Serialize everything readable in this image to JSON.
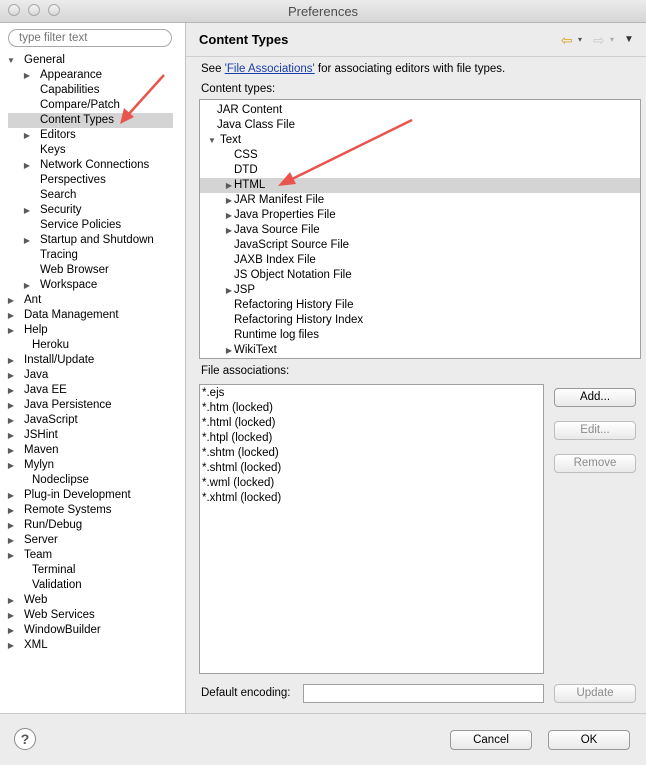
{
  "window": {
    "title": "Preferences"
  },
  "filter": {
    "placeholder": "type filter text"
  },
  "sidebar": {
    "items": [
      {
        "label": "General",
        "level": 0,
        "twisty": "open"
      },
      {
        "label": "Appearance",
        "level": 1,
        "twisty": "closed"
      },
      {
        "label": "Capabilities",
        "level": 1,
        "twisty": "none"
      },
      {
        "label": "Compare/Patch",
        "level": 1,
        "twisty": "none"
      },
      {
        "label": "Content Types",
        "level": 1,
        "twisty": "none",
        "selected": true
      },
      {
        "label": "Editors",
        "level": 1,
        "twisty": "closed"
      },
      {
        "label": "Keys",
        "level": 1,
        "twisty": "none"
      },
      {
        "label": "Network Connections",
        "level": 1,
        "twisty": "closed"
      },
      {
        "label": "Perspectives",
        "level": 1,
        "twisty": "none"
      },
      {
        "label": "Search",
        "level": 1,
        "twisty": "none"
      },
      {
        "label": "Security",
        "level": 1,
        "twisty": "closed"
      },
      {
        "label": "Service Policies",
        "level": 1,
        "twisty": "none"
      },
      {
        "label": "Startup and Shutdown",
        "level": 1,
        "twisty": "closed"
      },
      {
        "label": "Tracing",
        "level": 1,
        "twisty": "none"
      },
      {
        "label": "Web Browser",
        "level": 1,
        "twisty": "none"
      },
      {
        "label": "Workspace",
        "level": 1,
        "twisty": "closed"
      },
      {
        "label": "Ant",
        "level": 0,
        "twisty": "closed"
      },
      {
        "label": "Data Management",
        "level": 0,
        "twisty": "closed"
      },
      {
        "label": "Help",
        "level": 0,
        "twisty": "closed"
      },
      {
        "label": "Heroku",
        "level": 0,
        "twisty": "none"
      },
      {
        "label": "Install/Update",
        "level": 0,
        "twisty": "closed"
      },
      {
        "label": "Java",
        "level": 0,
        "twisty": "closed"
      },
      {
        "label": "Java EE",
        "level": 0,
        "twisty": "closed"
      },
      {
        "label": "Java Persistence",
        "level": 0,
        "twisty": "closed"
      },
      {
        "label": "JavaScript",
        "level": 0,
        "twisty": "closed"
      },
      {
        "label": "JSHint",
        "level": 0,
        "twisty": "closed"
      },
      {
        "label": "Maven",
        "level": 0,
        "twisty": "closed"
      },
      {
        "label": "Mylyn",
        "level": 0,
        "twisty": "closed"
      },
      {
        "label": "Nodeclipse",
        "level": 0,
        "twisty": "none"
      },
      {
        "label": "Plug-in Development",
        "level": 0,
        "twisty": "closed"
      },
      {
        "label": "Remote Systems",
        "level": 0,
        "twisty": "closed"
      },
      {
        "label": "Run/Debug",
        "level": 0,
        "twisty": "closed"
      },
      {
        "label": "Server",
        "level": 0,
        "twisty": "closed"
      },
      {
        "label": "Team",
        "level": 0,
        "twisty": "closed"
      },
      {
        "label": "Terminal",
        "level": 0,
        "twisty": "none"
      },
      {
        "label": "Validation",
        "level": 0,
        "twisty": "none"
      },
      {
        "label": "Web",
        "level": 0,
        "twisty": "closed"
      },
      {
        "label": "Web Services",
        "level": 0,
        "twisty": "closed"
      },
      {
        "label": "WindowBuilder",
        "level": 0,
        "twisty": "closed"
      },
      {
        "label": "XML",
        "level": 0,
        "twisty": "closed"
      }
    ]
  },
  "main": {
    "title": "Content Types",
    "intro_prefix": "See ",
    "intro_link": "'File Associations'",
    "intro_suffix": " for associating editors with file types.",
    "content_types_label": "Content types:",
    "content_types": [
      {
        "label": "JAR Content",
        "level": 0,
        "twisty": "none"
      },
      {
        "label": "Java Class File",
        "level": 0,
        "twisty": "none"
      },
      {
        "label": "Text",
        "level": 0,
        "twisty": "open"
      },
      {
        "label": "CSS",
        "level": 1,
        "twisty": "none"
      },
      {
        "label": "DTD",
        "level": 1,
        "twisty": "none"
      },
      {
        "label": "HTML",
        "level": 1,
        "twisty": "closed",
        "selected": true
      },
      {
        "label": "JAR Manifest File",
        "level": 1,
        "twisty": "closed"
      },
      {
        "label": "Java Properties File",
        "level": 1,
        "twisty": "closed"
      },
      {
        "label": "Java Source File",
        "level": 1,
        "twisty": "closed"
      },
      {
        "label": "JavaScript Source File",
        "level": 1,
        "twisty": "none"
      },
      {
        "label": "JAXB Index File",
        "level": 1,
        "twisty": "none"
      },
      {
        "label": "JS Object Notation File",
        "level": 1,
        "twisty": "none"
      },
      {
        "label": "JSP",
        "level": 1,
        "twisty": "closed"
      },
      {
        "label": "Refactoring History File",
        "level": 1,
        "twisty": "none"
      },
      {
        "label": "Refactoring History Index",
        "level": 1,
        "twisty": "none"
      },
      {
        "label": "Runtime log files",
        "level": 1,
        "twisty": "none"
      },
      {
        "label": "WikiText",
        "level": 1,
        "twisty": "closed"
      }
    ],
    "file_assoc_label": "File associations:",
    "file_associations": [
      "*.ejs",
      "*.htm (locked)",
      "*.html (locked)",
      "*.htpl (locked)",
      "*.shtm (locked)",
      "*.shtml (locked)",
      "*.wml (locked)",
      "*.xhtml (locked)"
    ],
    "buttons": {
      "add": "Add...",
      "edit": "Edit...",
      "remove": "Remove",
      "update": "Update"
    },
    "default_encoding_label": "Default encoding:",
    "default_encoding_value": ""
  },
  "footer": {
    "help": "?",
    "cancel": "Cancel",
    "ok": "OK"
  },
  "colors": {
    "annotation_arrow": "#e8554e",
    "link": "#1a3eaa",
    "selection": "#d4d4d4"
  }
}
